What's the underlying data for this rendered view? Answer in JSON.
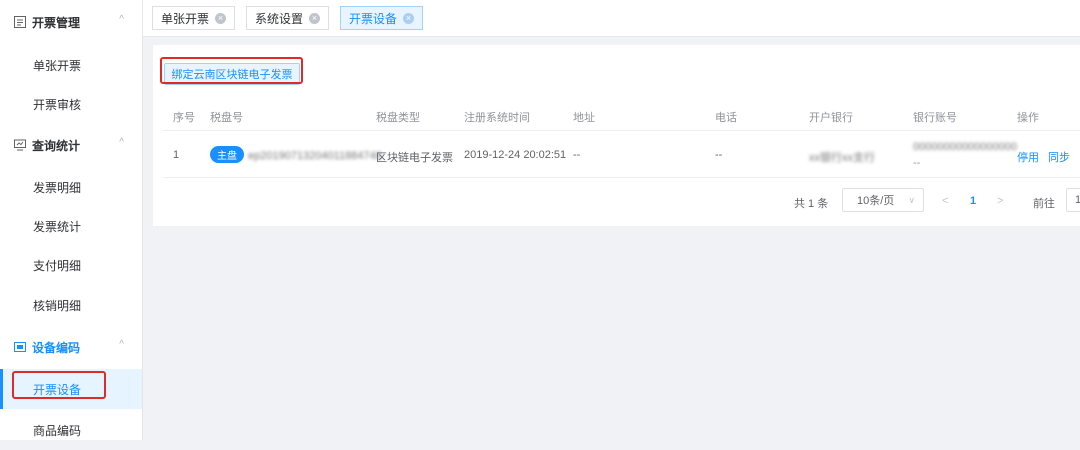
{
  "sidebar": {
    "groups": [
      {
        "label": "开票管理",
        "icon": "document-icon",
        "chevron": "^"
      },
      {
        "label": "查询统计",
        "icon": "monitor-icon",
        "chevron": "^"
      },
      {
        "label": "设备编码",
        "icon": "card-icon",
        "chevron": "^"
      }
    ],
    "items": [
      {
        "label": "单张开票"
      },
      {
        "label": "开票审核"
      },
      {
        "label": "发票明细"
      },
      {
        "label": "发票统计"
      },
      {
        "label": "支付明细"
      },
      {
        "label": "核销明细"
      },
      {
        "label": "开票设备"
      },
      {
        "label": "商品编码"
      }
    ]
  },
  "tabs": [
    {
      "label": "单张开票"
    },
    {
      "label": "系统设置"
    },
    {
      "label": "开票设备"
    }
  ],
  "toolbar": {
    "bind_button": "绑定云南区块链电子发票"
  },
  "table": {
    "headers": [
      "序号",
      "税盘号",
      "税盘类型",
      "注册系统时间",
      "地址",
      "电话",
      "开户银行",
      "银行账号",
      "操作"
    ],
    "row": {
      "index": "1",
      "badge": "主盘",
      "disk_no": "ep20190713204011884748",
      "disk_type": "区块链电子发票",
      "reg_time": "2019-12-24 20:02:51",
      "address": "--",
      "phone": "--",
      "bank": "xx银行xx支行",
      "account": "00000000000000000",
      "account2": "--",
      "action_disable": "停用",
      "action_sync": "同步"
    }
  },
  "pagination": {
    "total": "共 1 条",
    "page_size": "10条/页",
    "prev": "<",
    "current": "1",
    "next": ">",
    "goto_label": "前往",
    "goto_value": "1"
  },
  "colors": {
    "accent": "#1890ff",
    "highlight": "#e02a2a"
  }
}
